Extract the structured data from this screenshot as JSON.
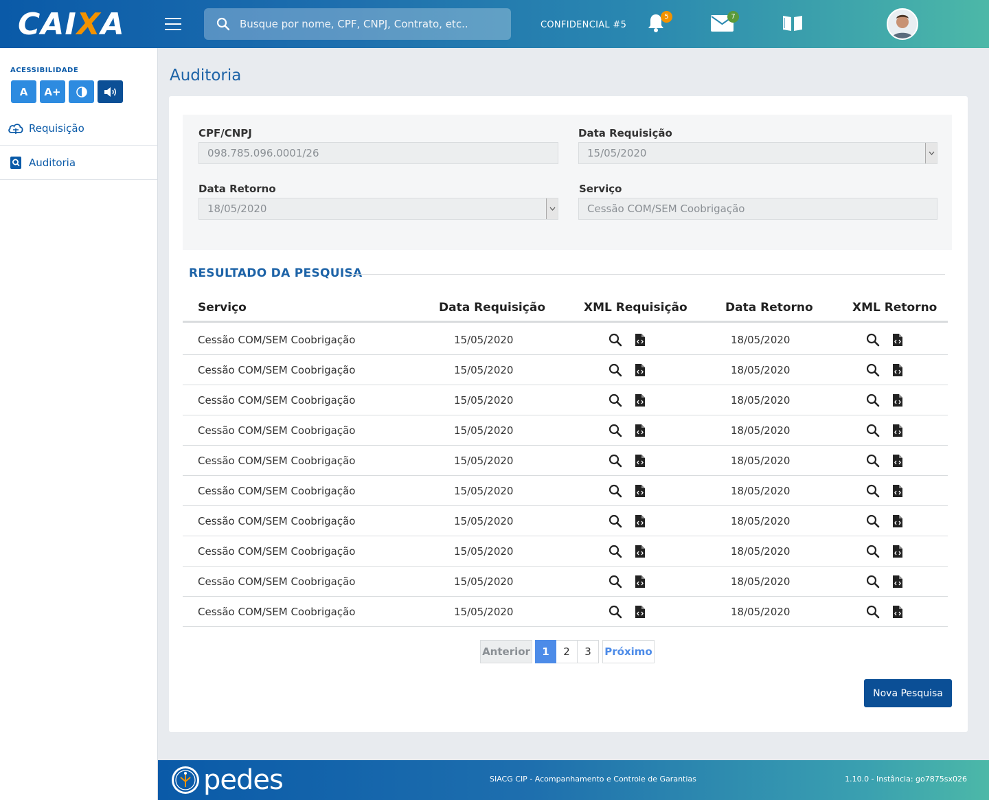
{
  "header": {
    "logo_prefix": "CAI",
    "logo_x": "X",
    "logo_suffix": "A",
    "search_placeholder": "Busque por nome, CPF, CNPJ, Contrato, etc..",
    "confidential": "CONFIDENCIAL #5",
    "notifications_count": "5",
    "messages_count": "7",
    "colors": {
      "gradient_start": "#0a5aa8",
      "gradient_end": "#4cb8a8",
      "accent_orange": "#f39200",
      "badge_orange": "#f39200",
      "badge_green": "#5a9a3a"
    }
  },
  "sidebar": {
    "accessibility_label": "ACESSIBILIDADE",
    "acc_buttons": [
      {
        "label": "A",
        "icon": "font-normal"
      },
      {
        "label": "A+",
        "icon": "font-increase"
      },
      {
        "label": "◐",
        "icon": "contrast-icon"
      },
      {
        "label": "🔊",
        "icon": "speaker-icon"
      }
    ],
    "items": [
      {
        "label": "Requisição",
        "icon": "cloud-icon"
      },
      {
        "label": "Auditoria",
        "icon": "search-doc-icon"
      }
    ]
  },
  "main": {
    "page_title": "Auditoria",
    "filters": {
      "cpf_label": "CPF/CNPJ",
      "cpf_value": "098.785.096.0001/26",
      "data_req_label": "Data Requisição",
      "data_req_value": "15/05/2020",
      "data_ret_label": "Data Retorno",
      "data_ret_value": "18/05/2020",
      "servico_label": "Serviço",
      "servico_value": "Cessão COM/SEM Coobrigação"
    },
    "result_title": "RESULTADO DA PESQUISA",
    "table": {
      "headers": [
        "Serviço",
        "Data Requisição",
        "XML Requisição",
        "Data Retorno",
        "XML Retorno"
      ],
      "rows": [
        {
          "servico": "Cessão COM/SEM Coobrigação",
          "data_req": "15/05/2020",
          "data_ret": "18/05/2020"
        },
        {
          "servico": "Cessão COM/SEM Coobrigação",
          "data_req": "15/05/2020",
          "data_ret": "18/05/2020"
        },
        {
          "servico": "Cessão COM/SEM Coobrigação",
          "data_req": "15/05/2020",
          "data_ret": "18/05/2020"
        },
        {
          "servico": "Cessão COM/SEM Coobrigação",
          "data_req": "15/05/2020",
          "data_ret": "18/05/2020"
        },
        {
          "servico": "Cessão COM/SEM Coobrigação",
          "data_req": "15/05/2020",
          "data_ret": "18/05/2020"
        },
        {
          "servico": "Cessão COM/SEM Coobrigação",
          "data_req": "15/05/2020",
          "data_ret": "18/05/2020"
        },
        {
          "servico": "Cessão COM/SEM Coobrigação",
          "data_req": "15/05/2020",
          "data_ret": "18/05/2020"
        },
        {
          "servico": "Cessão COM/SEM Coobrigação",
          "data_req": "15/05/2020",
          "data_ret": "18/05/2020"
        },
        {
          "servico": "Cessão COM/SEM Coobrigação",
          "data_req": "15/05/2020",
          "data_ret": "18/05/2020"
        },
        {
          "servico": "Cessão COM/SEM Coobrigação",
          "data_req": "15/05/2020",
          "data_ret": "18/05/2020"
        }
      ]
    },
    "pagination": {
      "prev": "Anterior",
      "pages": [
        "1",
        "2",
        "3"
      ],
      "current": "1",
      "next": "Próximo"
    },
    "nova_pesquisa": "Nova Pesquisa"
  },
  "footer": {
    "brand": "pedes",
    "center_text": "SIACG CIP - Acompanhamento e Controle de Garantias",
    "version": "1.10.0 - Instância: go7875sx026"
  }
}
